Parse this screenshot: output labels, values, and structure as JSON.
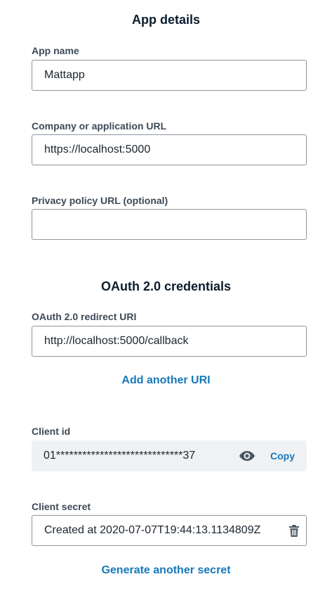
{
  "app_details": {
    "title": "App details",
    "app_name": {
      "label": "App name",
      "value": "Mattapp"
    },
    "company_url": {
      "label": "Company or application URL",
      "value": "https://localhost:5000"
    },
    "privacy_url": {
      "label": "Privacy policy URL (optional)",
      "value": ""
    }
  },
  "oauth": {
    "title": "OAuth 2.0 credentials",
    "redirect_uri": {
      "label": "OAuth 2.0 redirect URI",
      "value": "http://localhost:5000/callback"
    },
    "add_uri_label": "Add another URI",
    "client_id": {
      "label": "Client id",
      "value": "01*****************************37",
      "copy_label": "Copy",
      "reveal_icon": "eye-icon"
    },
    "client_secret": {
      "label": "Client secret",
      "value": "Created at 2020-07-07T19:44:13.1134809Z",
      "delete_icon": "trash-icon"
    },
    "generate_secret_label": "Generate another secret"
  },
  "colors": {
    "accent": "#1779ba",
    "label": "#3d4a57",
    "heading": "#0b1d2e",
    "border": "#8d969f",
    "readonly_bg": "#f0f1f3",
    "icon": "#4a5561"
  }
}
